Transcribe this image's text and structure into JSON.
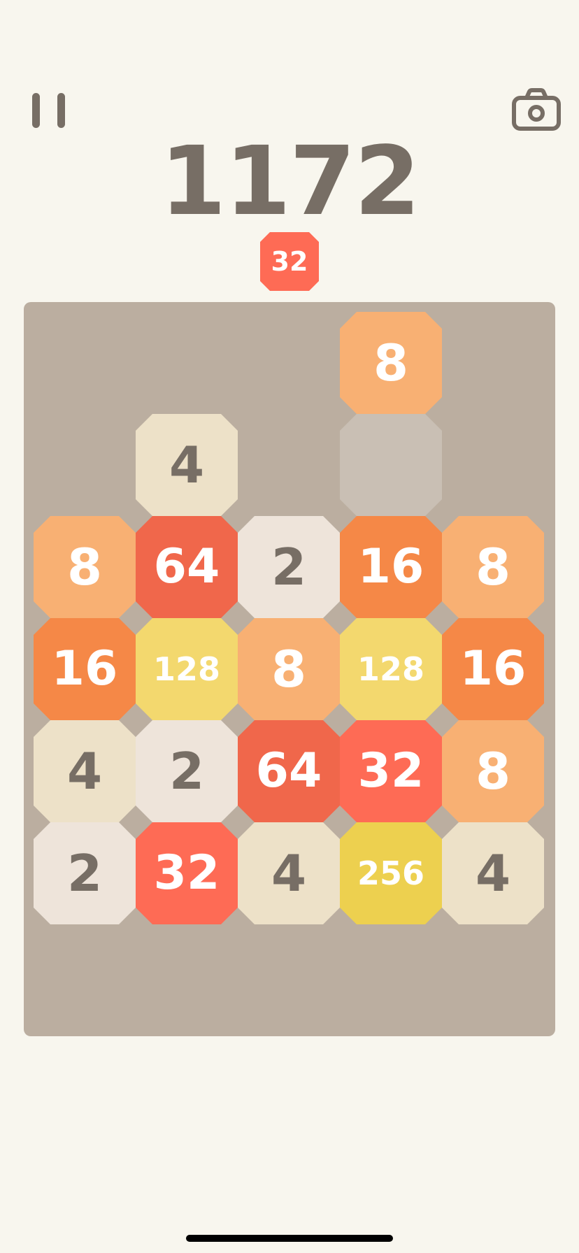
{
  "header": {
    "pause_icon": "pause-icon",
    "camera_icon": "camera-icon",
    "score": "1172",
    "target_tile": "32"
  },
  "colors": {
    "background": "#f8f6ee",
    "board": "#bbaea0",
    "text_dark": "#776e65",
    "text_light": "#ffffff"
  },
  "board": {
    "columns": 5,
    "rows": 7,
    "tiles": [
      {
        "row": 0,
        "col": 3,
        "value": "8"
      },
      {
        "row": 1,
        "col": 1,
        "value": "4"
      },
      {
        "row": 1,
        "col": 3,
        "value": ""
      },
      {
        "row": 2,
        "col": 0,
        "value": "8"
      },
      {
        "row": 2,
        "col": 1,
        "value": "64"
      },
      {
        "row": 2,
        "col": 2,
        "value": "2"
      },
      {
        "row": 2,
        "col": 3,
        "value": "16"
      },
      {
        "row": 2,
        "col": 4,
        "value": "8"
      },
      {
        "row": 3,
        "col": 0,
        "value": "16"
      },
      {
        "row": 3,
        "col": 1,
        "value": "128"
      },
      {
        "row": 3,
        "col": 2,
        "value": "8"
      },
      {
        "row": 3,
        "col": 3,
        "value": "128"
      },
      {
        "row": 3,
        "col": 4,
        "value": "16"
      },
      {
        "row": 4,
        "col": 0,
        "value": "4"
      },
      {
        "row": 4,
        "col": 1,
        "value": "2"
      },
      {
        "row": 4,
        "col": 2,
        "value": "64"
      },
      {
        "row": 4,
        "col": 3,
        "value": "32"
      },
      {
        "row": 4,
        "col": 4,
        "value": "8"
      },
      {
        "row": 5,
        "col": 0,
        "value": "2"
      },
      {
        "row": 5,
        "col": 1,
        "value": "32"
      },
      {
        "row": 5,
        "col": 2,
        "value": "4"
      },
      {
        "row": 5,
        "col": 3,
        "value": "256"
      },
      {
        "row": 5,
        "col": 4,
        "value": "4"
      }
    ]
  }
}
